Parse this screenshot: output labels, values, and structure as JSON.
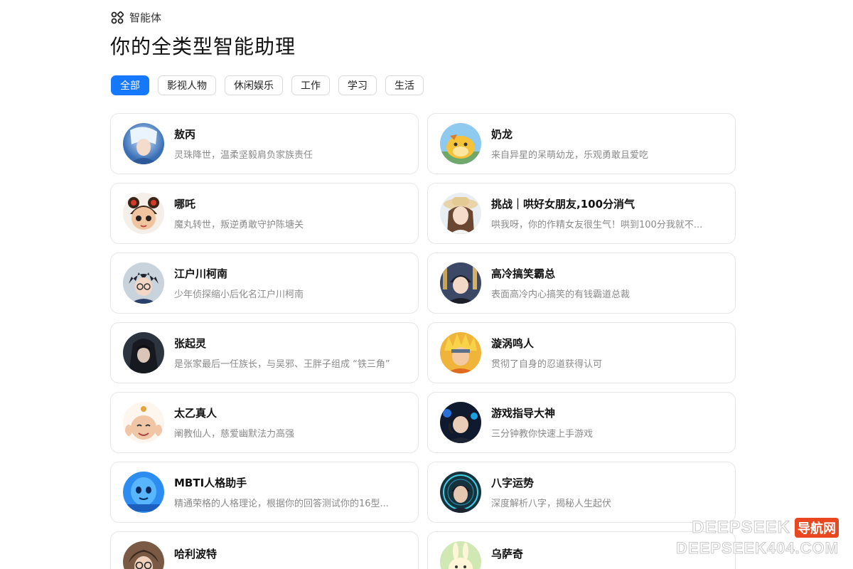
{
  "header": {
    "section_label": "智能体",
    "section_icon": "agents-grid-icon",
    "title": "你的全类型智能助理"
  },
  "tabs": [
    {
      "label": "全部",
      "active": true
    },
    {
      "label": "影视人物",
      "active": false
    },
    {
      "label": "休闲娱乐",
      "active": false
    },
    {
      "label": "工作",
      "active": false
    },
    {
      "label": "学习",
      "active": false
    },
    {
      "label": "生活",
      "active": false
    }
  ],
  "agents": [
    {
      "name": "敖丙",
      "desc": "灵珠降世，温柔坚毅肩负家族责任"
    },
    {
      "name": "奶龙",
      "desc": "来自异星的呆萌幼龙，乐观勇敢且爱吃"
    },
    {
      "name": "哪吒",
      "desc": "魔丸转世，叛逆勇敢守护陈塘关"
    },
    {
      "name": "挑战｜哄好女朋友,100分消气",
      "desc": "哄我呀，你的作精女友很生气！哄到100分我就不..."
    },
    {
      "name": "江户川柯南",
      "desc": "少年侦探缩小后化名江户川柯南"
    },
    {
      "name": "高冷搞笑霸总",
      "desc": "表面高冷内心搞笑的有钱霸道总裁"
    },
    {
      "name": "张起灵",
      "desc": "是张家最后一任族长，与吴邪、王胖子组成 “铁三角”"
    },
    {
      "name": "漩涡鸣人",
      "desc": "贯彻了自身的忍道获得认可"
    },
    {
      "name": "太乙真人",
      "desc": "阐教仙人，慈爱幽默法力高强"
    },
    {
      "name": "游戏指导大神",
      "desc": "三分钟教你快速上手游戏"
    },
    {
      "name": "MBTI人格助手",
      "desc": "精通荣格的人格理论，根据你的回答测试你的16型..."
    },
    {
      "name": "八字运势",
      "desc": "深度解析八字，揭秘人生起伏"
    },
    {
      "name": "哈利波特",
      "desc": "…"
    },
    {
      "name": "乌萨奇",
      "desc": "…"
    }
  ],
  "watermark": {
    "line1": "DEEPSEEK",
    "badge": "导航网",
    "line2": "DEEPSEEK404.COM"
  }
}
